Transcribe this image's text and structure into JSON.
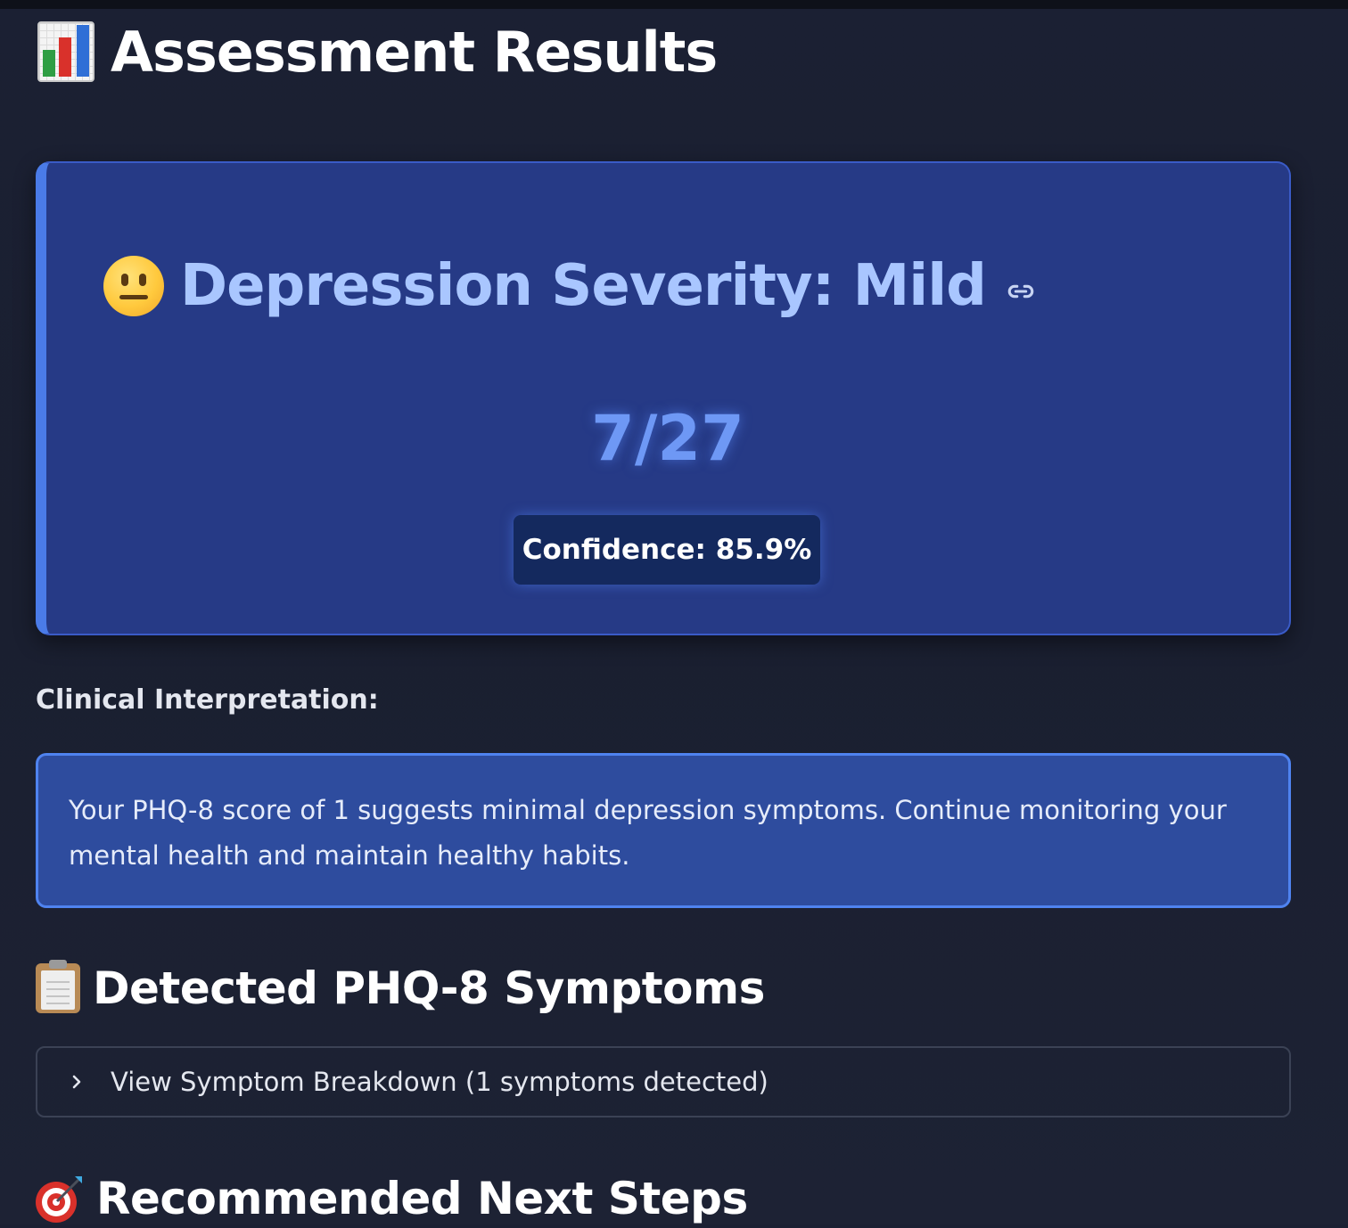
{
  "page": {
    "title": "Assessment Results",
    "title_icon": "bar-chart-icon"
  },
  "severity_card": {
    "heading": "Depression Severity: Mild",
    "heading_icon": "neutral-face-icon",
    "anchor_icon": "link-icon",
    "score": "7/27",
    "confidence": "Confidence: 85.9%",
    "accent_color": "#4a7be8",
    "background_color": "#263a86"
  },
  "interpretation": {
    "label": "Clinical Interpretation:",
    "text": "Your PHQ-8 score of 1 suggests minimal depression symptoms. Continue monitoring your mental health and maintain healthy habits."
  },
  "symptoms_section": {
    "heading": "Detected PHQ-8 Symptoms",
    "icon": "clipboard-icon",
    "expander_label": "View Symptom Breakdown (1 symptoms detected)",
    "expander_icon": "chevron-right-icon"
  },
  "next_steps_section": {
    "heading": "Recommended Next Steps",
    "icon": "direct-hit-target-icon"
  }
}
